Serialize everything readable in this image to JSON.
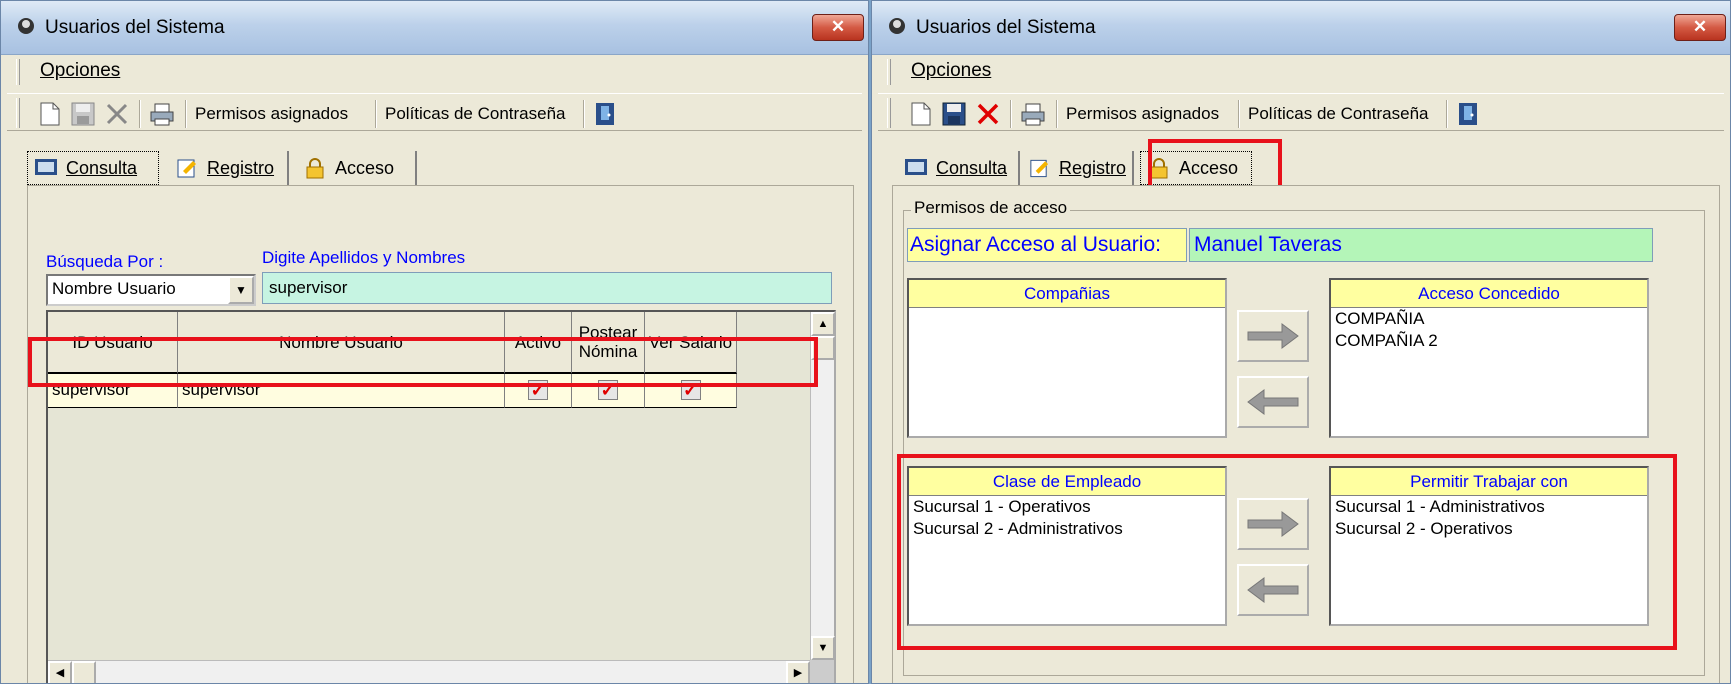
{
  "left_window": {
    "title": "Usuarios del Sistema",
    "menu": {
      "opciones": "Opciones"
    },
    "toolbar": {
      "permisos": "Permisos asignados",
      "politicas": "Políticas de Contraseña"
    },
    "tabs": [
      "Consulta",
      "Registro",
      "Acceso"
    ],
    "search": {
      "by_label": "Búsqueda Por :",
      "by_value": "Nombre Usuario",
      "name_label": "Digite Apellidos y Nombres",
      "name_value": "supervisor"
    },
    "grid": {
      "columns": [
        "ID Usuario",
        "Nombre Usuario",
        "Activo",
        "Postear Nómina",
        "Ver Salario"
      ],
      "rows": [
        {
          "id": "supervisor",
          "nombre": "supervisor",
          "activo": true,
          "postear": true,
          "ver_salario": true
        }
      ]
    }
  },
  "right_window": {
    "title": "Usuarios del Sistema",
    "menu": {
      "opciones": "Opciones"
    },
    "toolbar": {
      "permisos": "Permisos asignados",
      "politicas": "Políticas de Contraseña"
    },
    "tabs": [
      "Consulta",
      "Registro",
      "Acceso"
    ],
    "group_title": "Permisos de acceso",
    "assign_label": "Asignar Acceso al Usuario:",
    "assign_value": "Manuel Taveras",
    "companias": {
      "header": "Compañias",
      "items": []
    },
    "acceso_concedido": {
      "header": "Acceso Concedido",
      "items": [
        "COMPAÑIA",
        "COMPAÑIA 2"
      ]
    },
    "clase_empleado": {
      "header": "Clase de Empleado",
      "items": [
        "Sucursal 1 - Operativos",
        "Sucursal 2 - Administrativos"
      ]
    },
    "permitir_trabajar": {
      "header": "Permitir Trabajar con",
      "items": [
        "Sucursal 1 - Administrativos",
        "Sucursal 2 - Operativos"
      ]
    }
  },
  "colors": {
    "highlight": "#e8111b",
    "label_blue": "#0000ff",
    "input_mint": "#c6f4e2",
    "listbox_header": "#ffffa0",
    "assign_green": "#b4f5b8"
  }
}
